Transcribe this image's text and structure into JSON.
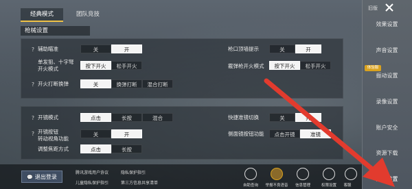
{
  "tabs": [
    "经典模式",
    "团队竞技"
  ],
  "section_title": "枪械设置",
  "panel1": {
    "aim_assist": {
      "label": "辅助瞄准",
      "options": [
        "关",
        "开"
      ]
    },
    "single_fire": {
      "label": "单发狙、十字弩\n开火模式",
      "options": [
        "按下开火",
        "松手开火"
      ]
    },
    "scope_switch": {
      "label": "开火打断换弹",
      "options": [
        "关",
        "换弹打断",
        "混合打断"
      ]
    },
    "muzzle_hint": {
      "label": "枪口顶墙提示",
      "options": [
        "关",
        "开"
      ]
    },
    "shotgun_fire": {
      "label": "霰弹枪开火模式",
      "options": [
        "按下开火",
        "松手开火"
      ]
    }
  },
  "panel2": {
    "scope_mode": {
      "label": "开镜模式",
      "options": [
        "点击",
        "长按",
        "混合"
      ]
    },
    "scope_button": {
      "label": "开镜按钮\n转动视角功能",
      "options": [
        "关",
        "开"
      ]
    },
    "focus_mode": {
      "label": "调整焦距方式",
      "options": [
        "点击",
        "长按"
      ]
    },
    "quick_scope": {
      "label": "快捷准镜切换",
      "options": [
        "关",
        "开"
      ]
    },
    "side_scope": {
      "label": "侧面镜按钮功能",
      "options": [
        "点击开镜",
        "准镜"
      ]
    }
  },
  "sidebar": {
    "back_label": "旧版",
    "items": [
      "效果设置",
      "声音设置",
      "振动设置",
      "录像设置",
      "账户安全",
      "资源下载",
      "隐私设置"
    ],
    "badge": "体验服"
  },
  "bottom": {
    "logout": "退出登录",
    "links": [
      "腾讯游戏用户协议",
      "隐私保护指引",
      "儿童隐私保护指引",
      "第三方信息共享清单"
    ],
    "icons": [
      "自助查询",
      "举报不良语音",
      "信息管理",
      "权限设置",
      "客服"
    ]
  },
  "colors": {
    "accent": "#f0c246",
    "arrow": "#e23b2e"
  }
}
